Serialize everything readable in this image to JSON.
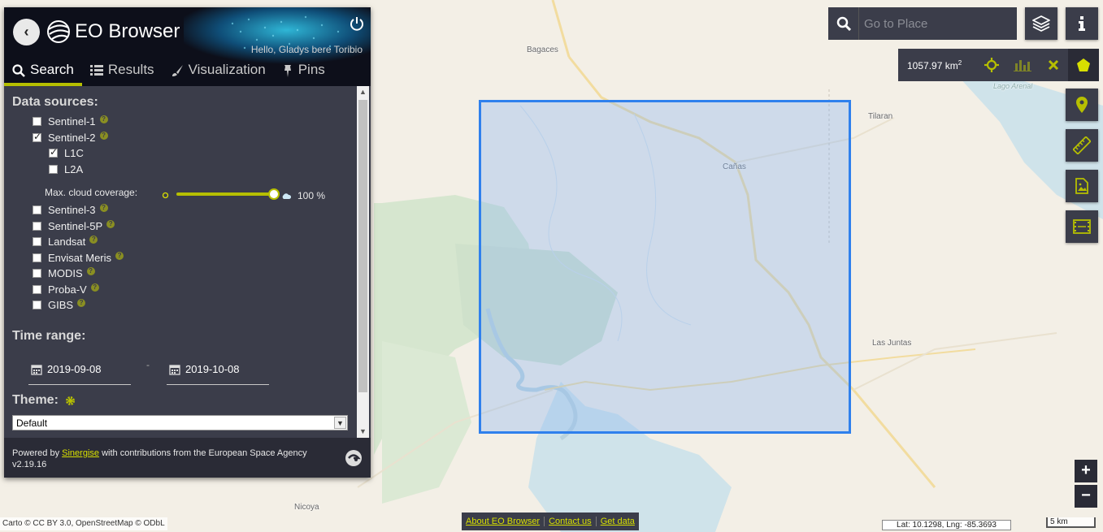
{
  "map": {
    "places": [
      "Bagaces",
      "Cañas",
      "Tilaran",
      "Lago Arenal",
      "Las Juntas",
      "Nicoya"
    ],
    "attribution": "Carto © CC BY 3.0, OpenStreetMap © ODbL",
    "coords": "Lat: 10.1298, Lng: -85.3693",
    "scale": "5 km"
  },
  "panel": {
    "title": "EO Browser",
    "greeting": "Hello, Gladys bere Toribio",
    "tabs": [
      {
        "label": "Search",
        "icon": "search-icon"
      },
      {
        "label": "Results",
        "icon": "list-icon"
      },
      {
        "label": "Visualization",
        "icon": "brush-icon"
      },
      {
        "label": "Pins",
        "icon": "pin-icon"
      }
    ],
    "data_sources_title": "Data sources:",
    "sources": {
      "s1": "Sentinel-1",
      "s2": "Sentinel-2",
      "l1c": "L1C",
      "l2a": "L2A",
      "s3": "Sentinel-3",
      "s5p": "Sentinel-5P",
      "landsat": "Landsat",
      "envisat": "Envisat Meris",
      "modis": "MODIS",
      "probav": "Proba-V",
      "gibs": "GIBS"
    },
    "cloud_label": "Max. cloud coverage:",
    "cloud_value": "100 %",
    "cloud_fraction": 1.0,
    "time_range_title": "Time range:",
    "date_from": "2019-09-08",
    "date_to": "2019-10-08",
    "date_separator": "-",
    "theme_title": "Theme:",
    "theme_value": "Default",
    "footer": {
      "powered_by": "Powered by",
      "sinergise": "Sinergise",
      "contributions": "with contributions from the European Space Agency",
      "version": "v2.19.16"
    }
  },
  "toolbar": {
    "search_placeholder": "Go to Place",
    "area": "1057.97 km",
    "area_unit_sup": "2"
  },
  "bottom_links": [
    "About EO Browser",
    "Contact us",
    "Get data"
  ],
  "zoom": {
    "in": "+",
    "out": "−"
  },
  "colors": {
    "accent": "#b6bf00",
    "panel": "#3b3d4a",
    "aoi": "#2f80ed"
  }
}
